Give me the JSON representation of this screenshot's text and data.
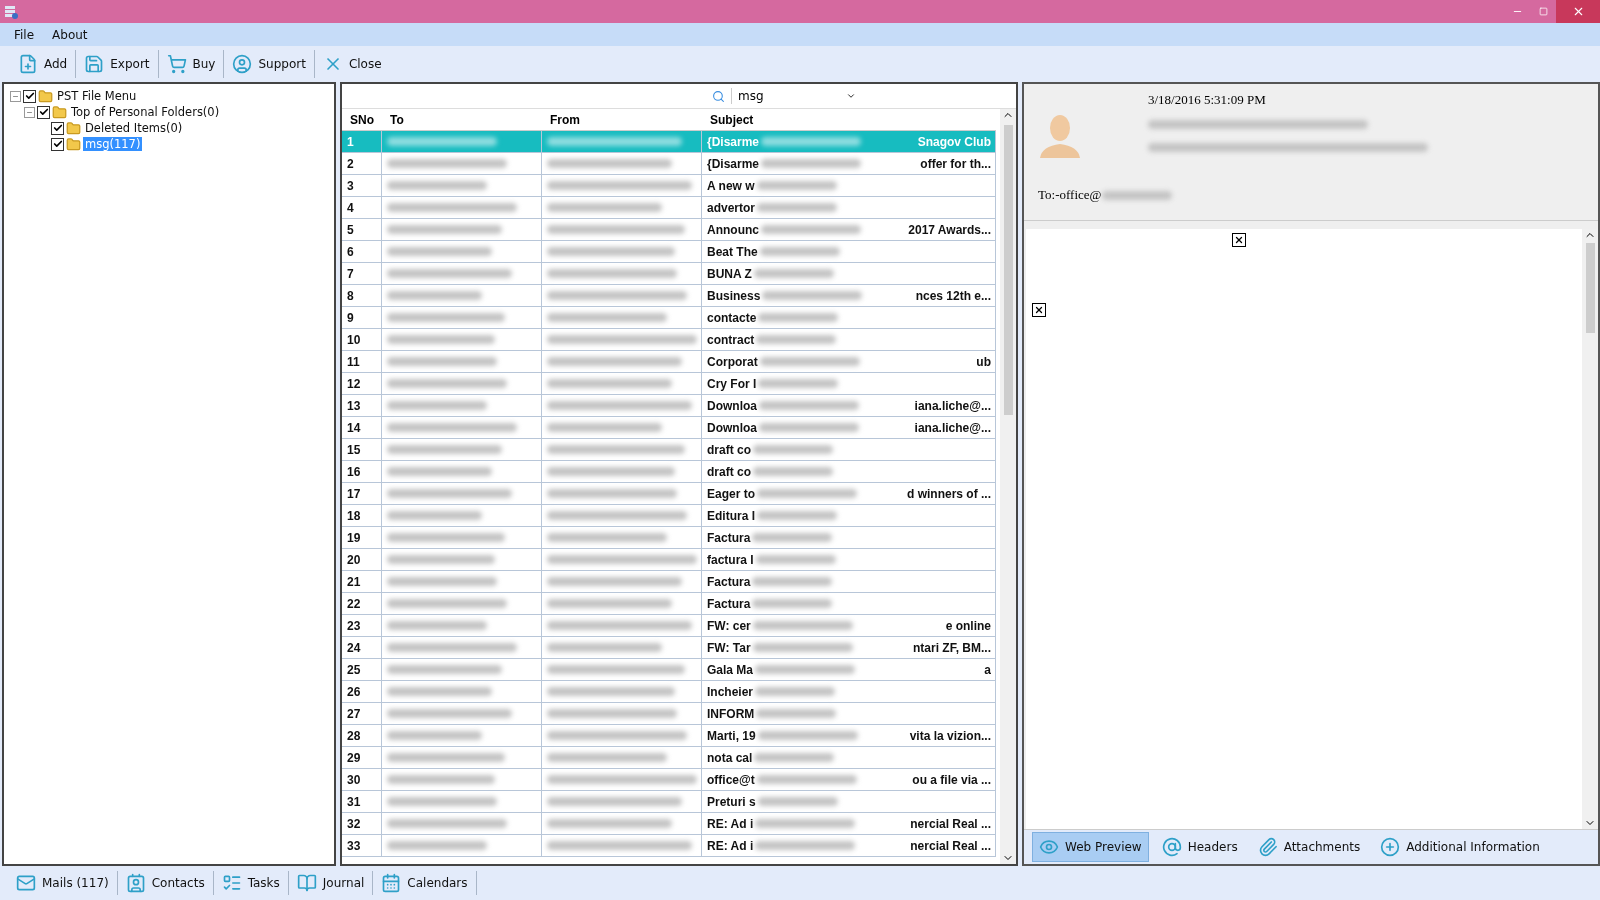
{
  "menu": [
    "File",
    "About"
  ],
  "toolbar": [
    {
      "kind": "add",
      "label": "Add"
    },
    {
      "kind": "export",
      "label": "Export"
    },
    {
      "kind": "buy",
      "label": "Buy"
    },
    {
      "kind": "support",
      "label": "Support"
    },
    {
      "kind": "close",
      "label": "Close"
    }
  ],
  "tree": [
    {
      "label": "PST File Menu",
      "checked": true,
      "expanded": true,
      "selected": false,
      "children": [
        {
          "label": "Top of Personal Folders(0)",
          "checked": true,
          "expanded": true,
          "selected": false,
          "children": [
            {
              "label": "Deleted Items(0)",
              "checked": true,
              "selected": false
            },
            {
              "label": "msg(117)",
              "checked": true,
              "selected": true
            }
          ]
        }
      ]
    }
  ],
  "search": {
    "value": "msg"
  },
  "table": {
    "columns": [
      "SNo",
      "To",
      "From",
      "Subject"
    ],
    "rows": [
      {
        "sno": "1",
        "subject_start": "{Disarme",
        "subject_end": "Snagov Club",
        "selected": true
      },
      {
        "sno": "2",
        "subject_start": "{Disarme",
        "subject_end": "offer for th...",
        "selected": false
      },
      {
        "sno": "3",
        "subject_start": "A new w",
        "selected": false
      },
      {
        "sno": "4",
        "subject_start": "advertor",
        "selected": false
      },
      {
        "sno": "5",
        "subject_start": "Announc",
        "subject_end": "2017 Awards...",
        "selected": false
      },
      {
        "sno": "6",
        "subject_start": "Beat The",
        "selected": false
      },
      {
        "sno": "7",
        "subject_start": "BUNA Z",
        "selected": false
      },
      {
        "sno": "8",
        "subject_start": "Business",
        "subject_end": "nces 12th e...",
        "selected": false
      },
      {
        "sno": "9",
        "subject_start": "contacte",
        "selected": false
      },
      {
        "sno": "10",
        "subject_start": "contract",
        "selected": false
      },
      {
        "sno": "11",
        "subject_start": "Corporat",
        "subject_end": "ub",
        "selected": false
      },
      {
        "sno": "12",
        "subject_start": "Cry For I",
        "selected": false
      },
      {
        "sno": "13",
        "subject_start": "Downloa",
        "subject_end": "iana.liche@...",
        "selected": false
      },
      {
        "sno": "14",
        "subject_start": "Downloa",
        "subject_end": "iana.liche@...",
        "selected": false
      },
      {
        "sno": "15",
        "subject_start": "draft co",
        "selected": false
      },
      {
        "sno": "16",
        "subject_start": "draft co",
        "selected": false
      },
      {
        "sno": "17",
        "subject_start": "Eager to",
        "subject_end": "d winners of ...",
        "selected": false
      },
      {
        "sno": "18",
        "subject_start": "Editura I",
        "selected": false
      },
      {
        "sno": "19",
        "subject_start": "Factura",
        "selected": false
      },
      {
        "sno": "20",
        "subject_start": "factura I",
        "selected": false
      },
      {
        "sno": "21",
        "subject_start": "Factura",
        "selected": false
      },
      {
        "sno": "22",
        "subject_start": "Factura",
        "selected": false
      },
      {
        "sno": "23",
        "subject_start": "FW: cer",
        "subject_end": "e online",
        "selected": false
      },
      {
        "sno": "24",
        "subject_start": "FW: Tar",
        "subject_end": "ntari ZF, BM...",
        "selected": false
      },
      {
        "sno": "25",
        "subject_start": "Gala Ma",
        "subject_end": "a",
        "selected": false
      },
      {
        "sno": "26",
        "subject_start": "Incheier",
        "selected": false
      },
      {
        "sno": "27",
        "subject_start": "INFORM",
        "selected": false
      },
      {
        "sno": "28",
        "subject_start": "Marti, 19",
        "subject_end": "vita la vizion...",
        "selected": false
      },
      {
        "sno": "29",
        "subject_start": "nota cal",
        "selected": false
      },
      {
        "sno": "30",
        "subject_start": "office@t",
        "subject_end": "ou a file via ...",
        "selected": false
      },
      {
        "sno": "31",
        "subject_start": "Preturi s",
        "selected": false
      },
      {
        "sno": "32",
        "subject_start": "RE: Ad i",
        "subject_end": "nercial Real ...",
        "selected": false
      },
      {
        "sno": "33",
        "subject_start": "RE: Ad i",
        "subject_end": "nercial Real ...",
        "selected": false
      }
    ]
  },
  "preview": {
    "date": "3/18/2016 5:31:09 PM",
    "to": "To:-office@"
  },
  "preview_tabs": [
    {
      "kind": "web",
      "label": "Web Preview",
      "selected": true
    },
    {
      "kind": "headers",
      "label": "Headers",
      "selected": false
    },
    {
      "kind": "attachments",
      "label": "Attachments",
      "selected": false
    },
    {
      "kind": "info",
      "label": "Additional Information",
      "selected": false
    }
  ],
  "nav": [
    {
      "kind": "mails",
      "label": "Mails (117)"
    },
    {
      "kind": "contacts",
      "label": "Contacts"
    },
    {
      "kind": "tasks",
      "label": "Tasks"
    },
    {
      "kind": "journal",
      "label": "Journal"
    },
    {
      "kind": "calendars",
      "label": "Calendars"
    }
  ]
}
